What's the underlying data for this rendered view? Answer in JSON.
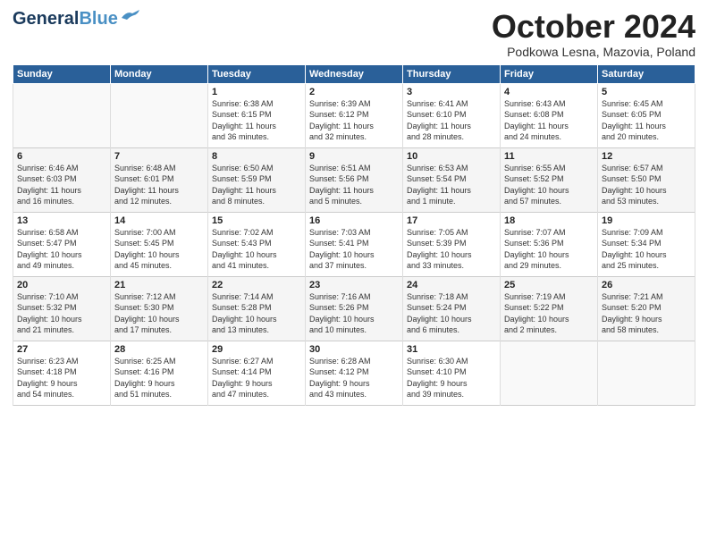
{
  "header": {
    "logo_line1": "General",
    "logo_line2": "Blue",
    "month": "October 2024",
    "location": "Podkowa Lesna, Mazovia, Poland"
  },
  "days_of_week": [
    "Sunday",
    "Monday",
    "Tuesday",
    "Wednesday",
    "Thursday",
    "Friday",
    "Saturday"
  ],
  "weeks": [
    [
      {
        "num": "",
        "info": ""
      },
      {
        "num": "",
        "info": ""
      },
      {
        "num": "1",
        "info": "Sunrise: 6:38 AM\nSunset: 6:15 PM\nDaylight: 11 hours\nand 36 minutes."
      },
      {
        "num": "2",
        "info": "Sunrise: 6:39 AM\nSunset: 6:12 PM\nDaylight: 11 hours\nand 32 minutes."
      },
      {
        "num": "3",
        "info": "Sunrise: 6:41 AM\nSunset: 6:10 PM\nDaylight: 11 hours\nand 28 minutes."
      },
      {
        "num": "4",
        "info": "Sunrise: 6:43 AM\nSunset: 6:08 PM\nDaylight: 11 hours\nand 24 minutes."
      },
      {
        "num": "5",
        "info": "Sunrise: 6:45 AM\nSunset: 6:05 PM\nDaylight: 11 hours\nand 20 minutes."
      }
    ],
    [
      {
        "num": "6",
        "info": "Sunrise: 6:46 AM\nSunset: 6:03 PM\nDaylight: 11 hours\nand 16 minutes."
      },
      {
        "num": "7",
        "info": "Sunrise: 6:48 AM\nSunset: 6:01 PM\nDaylight: 11 hours\nand 12 minutes."
      },
      {
        "num": "8",
        "info": "Sunrise: 6:50 AM\nSunset: 5:59 PM\nDaylight: 11 hours\nand 8 minutes."
      },
      {
        "num": "9",
        "info": "Sunrise: 6:51 AM\nSunset: 5:56 PM\nDaylight: 11 hours\nand 5 minutes."
      },
      {
        "num": "10",
        "info": "Sunrise: 6:53 AM\nSunset: 5:54 PM\nDaylight: 11 hours\nand 1 minute."
      },
      {
        "num": "11",
        "info": "Sunrise: 6:55 AM\nSunset: 5:52 PM\nDaylight: 10 hours\nand 57 minutes."
      },
      {
        "num": "12",
        "info": "Sunrise: 6:57 AM\nSunset: 5:50 PM\nDaylight: 10 hours\nand 53 minutes."
      }
    ],
    [
      {
        "num": "13",
        "info": "Sunrise: 6:58 AM\nSunset: 5:47 PM\nDaylight: 10 hours\nand 49 minutes."
      },
      {
        "num": "14",
        "info": "Sunrise: 7:00 AM\nSunset: 5:45 PM\nDaylight: 10 hours\nand 45 minutes."
      },
      {
        "num": "15",
        "info": "Sunrise: 7:02 AM\nSunset: 5:43 PM\nDaylight: 10 hours\nand 41 minutes."
      },
      {
        "num": "16",
        "info": "Sunrise: 7:03 AM\nSunset: 5:41 PM\nDaylight: 10 hours\nand 37 minutes."
      },
      {
        "num": "17",
        "info": "Sunrise: 7:05 AM\nSunset: 5:39 PM\nDaylight: 10 hours\nand 33 minutes."
      },
      {
        "num": "18",
        "info": "Sunrise: 7:07 AM\nSunset: 5:36 PM\nDaylight: 10 hours\nand 29 minutes."
      },
      {
        "num": "19",
        "info": "Sunrise: 7:09 AM\nSunset: 5:34 PM\nDaylight: 10 hours\nand 25 minutes."
      }
    ],
    [
      {
        "num": "20",
        "info": "Sunrise: 7:10 AM\nSunset: 5:32 PM\nDaylight: 10 hours\nand 21 minutes."
      },
      {
        "num": "21",
        "info": "Sunrise: 7:12 AM\nSunset: 5:30 PM\nDaylight: 10 hours\nand 17 minutes."
      },
      {
        "num": "22",
        "info": "Sunrise: 7:14 AM\nSunset: 5:28 PM\nDaylight: 10 hours\nand 13 minutes."
      },
      {
        "num": "23",
        "info": "Sunrise: 7:16 AM\nSunset: 5:26 PM\nDaylight: 10 hours\nand 10 minutes."
      },
      {
        "num": "24",
        "info": "Sunrise: 7:18 AM\nSunset: 5:24 PM\nDaylight: 10 hours\nand 6 minutes."
      },
      {
        "num": "25",
        "info": "Sunrise: 7:19 AM\nSunset: 5:22 PM\nDaylight: 10 hours\nand 2 minutes."
      },
      {
        "num": "26",
        "info": "Sunrise: 7:21 AM\nSunset: 5:20 PM\nDaylight: 9 hours\nand 58 minutes."
      }
    ],
    [
      {
        "num": "27",
        "info": "Sunrise: 6:23 AM\nSunset: 4:18 PM\nDaylight: 9 hours\nand 54 minutes."
      },
      {
        "num": "28",
        "info": "Sunrise: 6:25 AM\nSunset: 4:16 PM\nDaylight: 9 hours\nand 51 minutes."
      },
      {
        "num": "29",
        "info": "Sunrise: 6:27 AM\nSunset: 4:14 PM\nDaylight: 9 hours\nand 47 minutes."
      },
      {
        "num": "30",
        "info": "Sunrise: 6:28 AM\nSunset: 4:12 PM\nDaylight: 9 hours\nand 43 minutes."
      },
      {
        "num": "31",
        "info": "Sunrise: 6:30 AM\nSunset: 4:10 PM\nDaylight: 9 hours\nand 39 minutes."
      },
      {
        "num": "",
        "info": ""
      },
      {
        "num": "",
        "info": ""
      }
    ]
  ]
}
